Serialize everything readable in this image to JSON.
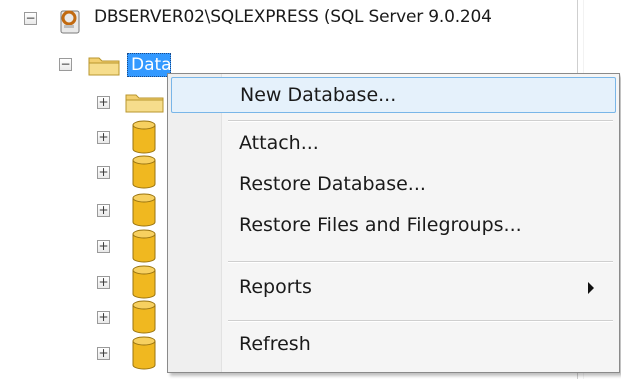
{
  "tree": {
    "server_label": "DBSERVER02\\SQLEXPRESS (SQL Server 9.0.204",
    "databases_folder_label": "Databases",
    "expander_minus": "−",
    "expander_plus": "+"
  },
  "context_menu": {
    "items": [
      {
        "label": "New Database...",
        "highlighted": true
      },
      {
        "label": "Attach..."
      },
      {
        "label": "Restore Database..."
      },
      {
        "label": "Restore Files and Filegroups..."
      },
      {
        "label": "Reports",
        "has_submenu": true
      },
      {
        "label": "Refresh"
      }
    ]
  },
  "colors": {
    "selection_blue": "#3399ff",
    "menu_highlight_bg": "#e5f1fb",
    "menu_highlight_border": "#79b6e8",
    "folder_yellow": "#f3d070",
    "database_cylinder": "#f0b820"
  },
  "icons": {
    "server": "server-icon",
    "folder": "folder-icon",
    "database": "database-icon",
    "expander_minus": "minus-expander-icon",
    "expander_plus": "plus-expander-icon",
    "submenu": "submenu-arrow-icon"
  }
}
